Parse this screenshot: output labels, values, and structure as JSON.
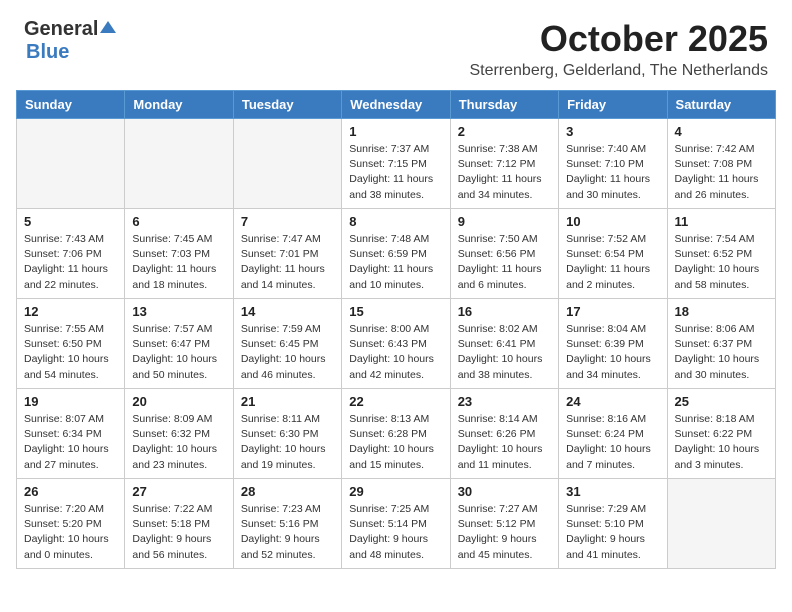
{
  "logo": {
    "general": "General",
    "blue": "Blue"
  },
  "title": "October 2025",
  "location": "Sterrenberg, Gelderland, The Netherlands",
  "weekdays": [
    "Sunday",
    "Monday",
    "Tuesday",
    "Wednesday",
    "Thursday",
    "Friday",
    "Saturday"
  ],
  "weeks": [
    [
      {
        "day": "",
        "info": ""
      },
      {
        "day": "",
        "info": ""
      },
      {
        "day": "",
        "info": ""
      },
      {
        "day": "1",
        "info": "Sunrise: 7:37 AM\nSunset: 7:15 PM\nDaylight: 11 hours and 38 minutes."
      },
      {
        "day": "2",
        "info": "Sunrise: 7:38 AM\nSunset: 7:12 PM\nDaylight: 11 hours and 34 minutes."
      },
      {
        "day": "3",
        "info": "Sunrise: 7:40 AM\nSunset: 7:10 PM\nDaylight: 11 hours and 30 minutes."
      },
      {
        "day": "4",
        "info": "Sunrise: 7:42 AM\nSunset: 7:08 PM\nDaylight: 11 hours and 26 minutes."
      }
    ],
    [
      {
        "day": "5",
        "info": "Sunrise: 7:43 AM\nSunset: 7:06 PM\nDaylight: 11 hours and 22 minutes."
      },
      {
        "day": "6",
        "info": "Sunrise: 7:45 AM\nSunset: 7:03 PM\nDaylight: 11 hours and 18 minutes."
      },
      {
        "day": "7",
        "info": "Sunrise: 7:47 AM\nSunset: 7:01 PM\nDaylight: 11 hours and 14 minutes."
      },
      {
        "day": "8",
        "info": "Sunrise: 7:48 AM\nSunset: 6:59 PM\nDaylight: 11 hours and 10 minutes."
      },
      {
        "day": "9",
        "info": "Sunrise: 7:50 AM\nSunset: 6:56 PM\nDaylight: 11 hours and 6 minutes."
      },
      {
        "day": "10",
        "info": "Sunrise: 7:52 AM\nSunset: 6:54 PM\nDaylight: 11 hours and 2 minutes."
      },
      {
        "day": "11",
        "info": "Sunrise: 7:54 AM\nSunset: 6:52 PM\nDaylight: 10 hours and 58 minutes."
      }
    ],
    [
      {
        "day": "12",
        "info": "Sunrise: 7:55 AM\nSunset: 6:50 PM\nDaylight: 10 hours and 54 minutes."
      },
      {
        "day": "13",
        "info": "Sunrise: 7:57 AM\nSunset: 6:47 PM\nDaylight: 10 hours and 50 minutes."
      },
      {
        "day": "14",
        "info": "Sunrise: 7:59 AM\nSunset: 6:45 PM\nDaylight: 10 hours and 46 minutes."
      },
      {
        "day": "15",
        "info": "Sunrise: 8:00 AM\nSunset: 6:43 PM\nDaylight: 10 hours and 42 minutes."
      },
      {
        "day": "16",
        "info": "Sunrise: 8:02 AM\nSunset: 6:41 PM\nDaylight: 10 hours and 38 minutes."
      },
      {
        "day": "17",
        "info": "Sunrise: 8:04 AM\nSunset: 6:39 PM\nDaylight: 10 hours and 34 minutes."
      },
      {
        "day": "18",
        "info": "Sunrise: 8:06 AM\nSunset: 6:37 PM\nDaylight: 10 hours and 30 minutes."
      }
    ],
    [
      {
        "day": "19",
        "info": "Sunrise: 8:07 AM\nSunset: 6:34 PM\nDaylight: 10 hours and 27 minutes."
      },
      {
        "day": "20",
        "info": "Sunrise: 8:09 AM\nSunset: 6:32 PM\nDaylight: 10 hours and 23 minutes."
      },
      {
        "day": "21",
        "info": "Sunrise: 8:11 AM\nSunset: 6:30 PM\nDaylight: 10 hours and 19 minutes."
      },
      {
        "day": "22",
        "info": "Sunrise: 8:13 AM\nSunset: 6:28 PM\nDaylight: 10 hours and 15 minutes."
      },
      {
        "day": "23",
        "info": "Sunrise: 8:14 AM\nSunset: 6:26 PM\nDaylight: 10 hours and 11 minutes."
      },
      {
        "day": "24",
        "info": "Sunrise: 8:16 AM\nSunset: 6:24 PM\nDaylight: 10 hours and 7 minutes."
      },
      {
        "day": "25",
        "info": "Sunrise: 8:18 AM\nSunset: 6:22 PM\nDaylight: 10 hours and 3 minutes."
      }
    ],
    [
      {
        "day": "26",
        "info": "Sunrise: 7:20 AM\nSunset: 5:20 PM\nDaylight: 10 hours and 0 minutes."
      },
      {
        "day": "27",
        "info": "Sunrise: 7:22 AM\nSunset: 5:18 PM\nDaylight: 9 hours and 56 minutes."
      },
      {
        "day": "28",
        "info": "Sunrise: 7:23 AM\nSunset: 5:16 PM\nDaylight: 9 hours and 52 minutes."
      },
      {
        "day": "29",
        "info": "Sunrise: 7:25 AM\nSunset: 5:14 PM\nDaylight: 9 hours and 48 minutes."
      },
      {
        "day": "30",
        "info": "Sunrise: 7:27 AM\nSunset: 5:12 PM\nDaylight: 9 hours and 45 minutes."
      },
      {
        "day": "31",
        "info": "Sunrise: 7:29 AM\nSunset: 5:10 PM\nDaylight: 9 hours and 41 minutes."
      },
      {
        "day": "",
        "info": ""
      }
    ]
  ]
}
